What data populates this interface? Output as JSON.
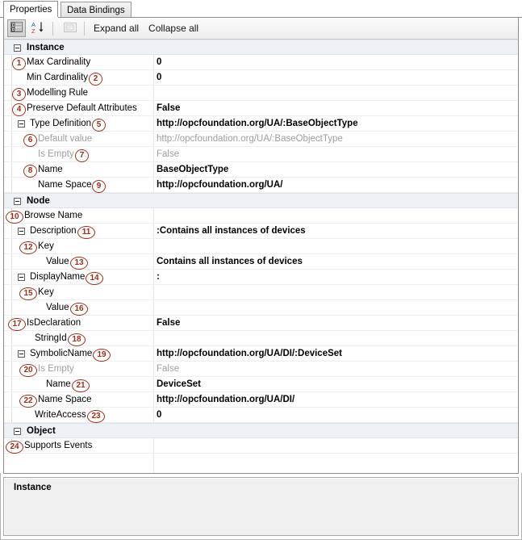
{
  "tabs": [
    {
      "label": "Properties",
      "active": true
    },
    {
      "label": "Data Bindings",
      "active": false
    }
  ],
  "toolbar": {
    "categorized_icon": "categorized-view-icon",
    "alphabetical_icon": "sort-alphabetical-icon",
    "property_pages_icon": "property-pages-icon",
    "expand_all_label": "Expand all",
    "collapse_all_label": "Collapse all"
  },
  "colors": {
    "annotation": "#9c2c18",
    "category_row_bg": "#eef1f6",
    "dim_text": "#9d9d9d"
  },
  "grid": {
    "rows": [
      {
        "kind": "category",
        "label": "Instance",
        "value": "",
        "indent": 28,
        "expander": 12,
        "anno": null,
        "anno_side": null
      },
      {
        "kind": "property",
        "label": "Max Cardinality",
        "value": "0",
        "indent": 28,
        "expander": null,
        "anno": "1",
        "anno_side": "left"
      },
      {
        "kind": "property",
        "label": "Min Cardinality",
        "value": "0",
        "indent": 28,
        "expander": null,
        "anno": "2",
        "anno_side": "right"
      },
      {
        "kind": "property",
        "label": "Modelling Rule",
        "value": "",
        "indent": 28,
        "expander": null,
        "anno": "3",
        "anno_side": "left"
      },
      {
        "kind": "property",
        "label": "Preserve Default Attributes",
        "value": "False",
        "indent": 28,
        "expander": null,
        "anno": "4",
        "anno_side": "left"
      },
      {
        "kind": "property",
        "label": "Type Definition",
        "value": "http://opcfoundation.org/UA/:BaseObjectType",
        "indent": 32,
        "expander": 17,
        "anno": "5",
        "anno_side": "right"
      },
      {
        "kind": "dim",
        "label": "Default value",
        "value": "http://opcfoundation.org/UA/:BaseObjectType",
        "indent": 42,
        "expander": null,
        "anno": "6",
        "anno_side": "left"
      },
      {
        "kind": "dim",
        "label": "Is Empty",
        "value": "False",
        "indent": 42,
        "expander": null,
        "anno": "7",
        "anno_side": "right"
      },
      {
        "kind": "property",
        "label": "Name",
        "value": "BaseObjectType",
        "indent": 42,
        "expander": null,
        "anno": "8",
        "anno_side": "left"
      },
      {
        "kind": "property",
        "label": "Name Space",
        "value": "http://opcfoundation.org/UA/",
        "indent": 42,
        "expander": null,
        "anno": "9",
        "anno_side": "right"
      },
      {
        "kind": "category",
        "label": "Node",
        "value": "",
        "indent": 28,
        "expander": 12,
        "anno": null,
        "anno_side": null
      },
      {
        "kind": "property",
        "label": "Browse Name",
        "value": "",
        "indent": 25,
        "expander": null,
        "anno": "10",
        "anno_side": "left"
      },
      {
        "kind": "property",
        "label": "Description",
        "value": ":Contains all instances of devices",
        "indent": 32,
        "expander": 17,
        "anno": "11",
        "anno_side": "right"
      },
      {
        "kind": "property",
        "label": "Key",
        "value": "",
        "indent": 42,
        "expander": null,
        "anno": "12",
        "anno_side": "left"
      },
      {
        "kind": "property",
        "label": "Value",
        "value": "Contains all instances of devices",
        "indent": 52,
        "expander": null,
        "anno": "13",
        "anno_side": "right"
      },
      {
        "kind": "property",
        "label": "DisplayName",
        "value": ":",
        "indent": 32,
        "expander": 17,
        "anno": "14",
        "anno_side": "right"
      },
      {
        "kind": "property",
        "label": "Key",
        "value": "",
        "indent": 42,
        "expander": null,
        "anno": "15",
        "anno_side": "left"
      },
      {
        "kind": "property",
        "label": "Value",
        "value": "",
        "indent": 52,
        "expander": null,
        "anno": "16",
        "anno_side": "right"
      },
      {
        "kind": "property",
        "label": "IsDeclaration",
        "value": "False",
        "indent": 28,
        "expander": null,
        "anno": "17",
        "anno_side": "left"
      },
      {
        "kind": "property",
        "label": "StringId",
        "value": "",
        "indent": 38,
        "expander": null,
        "anno": "18",
        "anno_side": "right"
      },
      {
        "kind": "property",
        "label": "SymbolicName",
        "value": "http://opcfoundation.org/UA/DI/:DeviceSet",
        "indent": 32,
        "expander": 17,
        "anno": "19",
        "anno_side": "right"
      },
      {
        "kind": "dim",
        "label": "Is Empty",
        "value": "False",
        "indent": 42,
        "expander": null,
        "anno": "20",
        "anno_side": "left"
      },
      {
        "kind": "property",
        "label": "Name",
        "value": "DeviceSet",
        "indent": 52,
        "expander": null,
        "anno": "21",
        "anno_side": "right"
      },
      {
        "kind": "property",
        "label": "Name Space",
        "value": "http://opcfoundation.org/UA/DI/",
        "indent": 42,
        "expander": null,
        "anno": "22",
        "anno_side": "left"
      },
      {
        "kind": "property",
        "label": "WriteAccess",
        "value": "0",
        "indent": 38,
        "expander": null,
        "anno": "23",
        "anno_side": "right"
      },
      {
        "kind": "category",
        "label": "Object",
        "value": "",
        "indent": 28,
        "expander": 12,
        "anno": null,
        "anno_side": null
      },
      {
        "kind": "property",
        "label": "Supports Events",
        "value": "",
        "indent": 25,
        "expander": null,
        "anno": "24",
        "anno_side": "left"
      }
    ]
  },
  "description_pane": {
    "title": "Instance",
    "text": ""
  }
}
